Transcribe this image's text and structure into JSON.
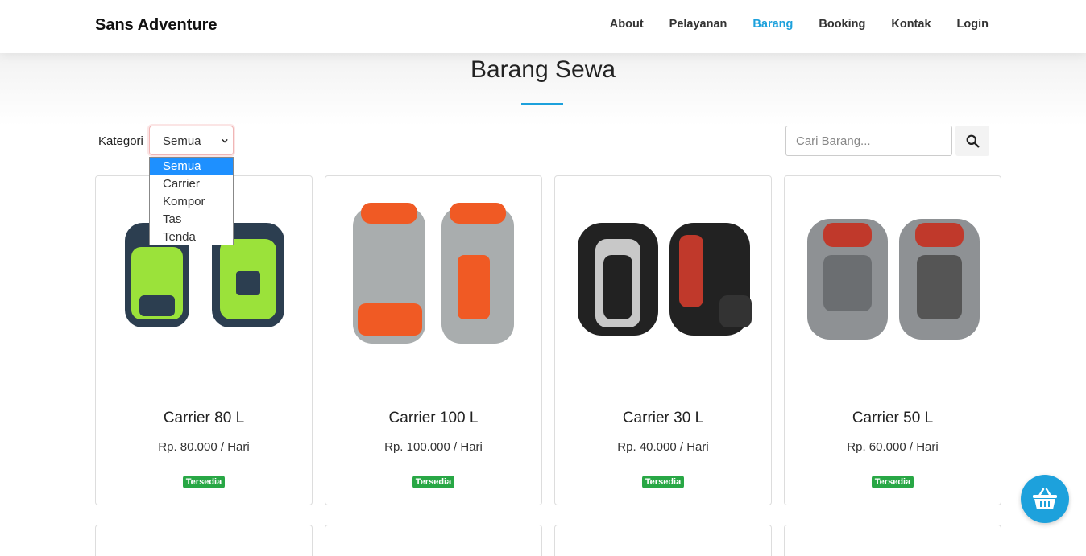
{
  "brand": "Sans Adventure",
  "nav": [
    {
      "label": "About",
      "active": false
    },
    {
      "label": "Pelayanan",
      "active": false
    },
    {
      "label": "Barang",
      "active": true
    },
    {
      "label": "Booking",
      "active": false
    },
    {
      "label": "Kontak",
      "active": false
    },
    {
      "label": "Login",
      "active": false
    }
  ],
  "section_title": "Barang Sewa",
  "filter": {
    "label": "Kategori",
    "selected": "Semua",
    "options": [
      "Semua",
      "Carrier",
      "Kompor",
      "Tas",
      "Tenda"
    ]
  },
  "search": {
    "placeholder": "Cari Barang..."
  },
  "products": [
    {
      "name": "Carrier 80 L",
      "price": "Rp. 80.000 / Hari",
      "status": "Tersedia",
      "color_main": "#9be23a",
      "color_accent": "#2c3e50"
    },
    {
      "name": "Carrier 100 L",
      "price": "Rp. 100.000 / Hari",
      "status": "Tersedia",
      "color_main": "#a9adae",
      "color_accent": "#f05a24"
    },
    {
      "name": "Carrier 30 L",
      "price": "Rp. 40.000 / Hari",
      "status": "Tersedia",
      "color_main": "#222222",
      "color_accent": "#c0392b"
    },
    {
      "name": "Carrier 50 L",
      "price": "Rp. 60.000 / Hari",
      "status": "Tersedia",
      "color_main": "#8e9194",
      "color_accent": "#c0392b"
    }
  ],
  "colors": {
    "accent": "#1da1dc",
    "badge": "#28a745"
  },
  "cart_icon": "basket-icon"
}
